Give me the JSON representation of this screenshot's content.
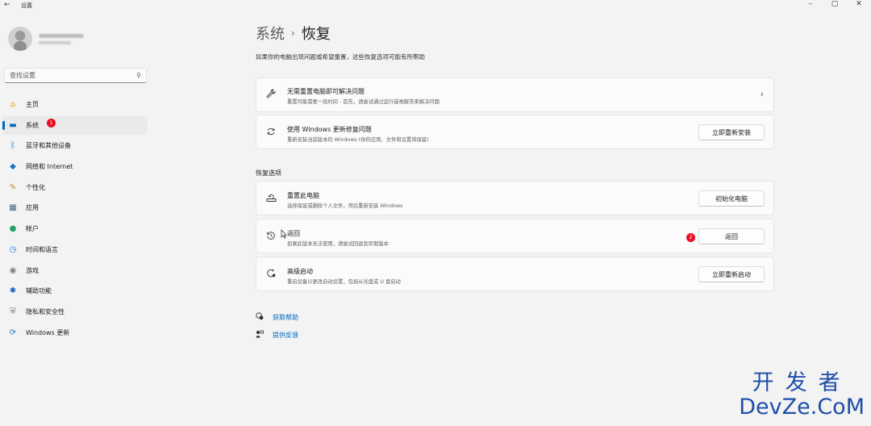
{
  "window": {
    "title": "设置",
    "back_icon": "←",
    "minimize": "–",
    "maximize": "▢",
    "close": "✕"
  },
  "sidebar": {
    "search_placeholder": "查找设置",
    "items": [
      {
        "label": "主页",
        "icon": "home-icon",
        "glyph": "⌂",
        "color": "#e8a317"
      },
      {
        "label": "系统",
        "icon": "system-icon",
        "glyph": "▬",
        "color": "#0067c0",
        "active": true,
        "badge": "1"
      },
      {
        "label": "蓝牙和其他设备",
        "icon": "bluetooth-icon",
        "glyph": "ᛒ",
        "color": "#0078d4"
      },
      {
        "label": "网络和 Internet",
        "icon": "wifi-icon",
        "glyph": "◆",
        "color": "#1a73c5"
      },
      {
        "label": "个性化",
        "icon": "brush-icon",
        "glyph": "✎",
        "color": "#c28a3a"
      },
      {
        "label": "应用",
        "icon": "apps-icon",
        "glyph": "▦",
        "color": "#4a5f82"
      },
      {
        "label": "帐户",
        "icon": "account-icon",
        "glyph": "●",
        "color": "#23a26d"
      },
      {
        "label": "时间和语言",
        "icon": "clock-globe-icon",
        "glyph": "◷",
        "color": "#1c7fd6"
      },
      {
        "label": "游戏",
        "icon": "gamepad-icon",
        "glyph": "◉",
        "color": "#7a7a7a"
      },
      {
        "label": "辅助功能",
        "icon": "accessibility-icon",
        "glyph": "✱",
        "color": "#1a5fb4"
      },
      {
        "label": "隐私和安全性",
        "icon": "shield-icon",
        "glyph": "⛨",
        "color": "#6b6b6b"
      },
      {
        "label": "Windows 更新",
        "icon": "windows-update-icon",
        "glyph": "⟳",
        "color": "#1c7fd6"
      }
    ]
  },
  "main": {
    "breadcrumb_parent": "系统",
    "breadcrumb_sep": "›",
    "breadcrumb_current": "恢复",
    "subtitle": "如果你的电脑出现问题或希望重置，这些恢复选项可能有所帮助",
    "top_cards": [
      {
        "title": "无需重置电脑即可解决问题",
        "desc": "重置可能需要一段时间 - 首先，请尝试通过运行疑难解答来解决问题",
        "icon": "wrench-icon",
        "glyph": "🔧",
        "chevron": "›"
      },
      {
        "title": "使用 Windows 更新修复问题",
        "desc": "重新安装当前版本的 Windows (你的应用、文件和设置将保留)",
        "icon": "refresh-icon",
        "glyph": "⟳",
        "button": "立即重新安装"
      }
    ],
    "section_title": "恢复选项",
    "recovery_cards": [
      {
        "title": "重置此电脑",
        "desc": "选择保留或删除个人文件，然后重新安装 Windows",
        "icon": "reset-pc-icon",
        "glyph": "⌂",
        "button": "初始化电脑"
      },
      {
        "title": "返回",
        "desc": "如果此版本无法使用，请尝试回退到早期版本",
        "icon": "history-icon",
        "glyph": "↺",
        "button": "返回",
        "badge": "2"
      },
      {
        "title": "高级启动",
        "desc": "重启设备以更改启动设置，包括从光盘或 U 盘启动",
        "icon": "advanced-startup-icon",
        "glyph": "⟲",
        "button": "立即重新启动"
      }
    ],
    "links": [
      {
        "label": "获取帮助",
        "icon": "help-icon",
        "glyph": "❓"
      },
      {
        "label": "提供反馈",
        "icon": "feedback-icon",
        "glyph": "✎"
      }
    ]
  },
  "watermark": {
    "cn": "开发者",
    "en": "DevZe.CoM"
  },
  "colors": {
    "accent": "#0067c0",
    "badge": "#e81123",
    "background": "#f3f3f3",
    "card": "#fbfbfb"
  }
}
